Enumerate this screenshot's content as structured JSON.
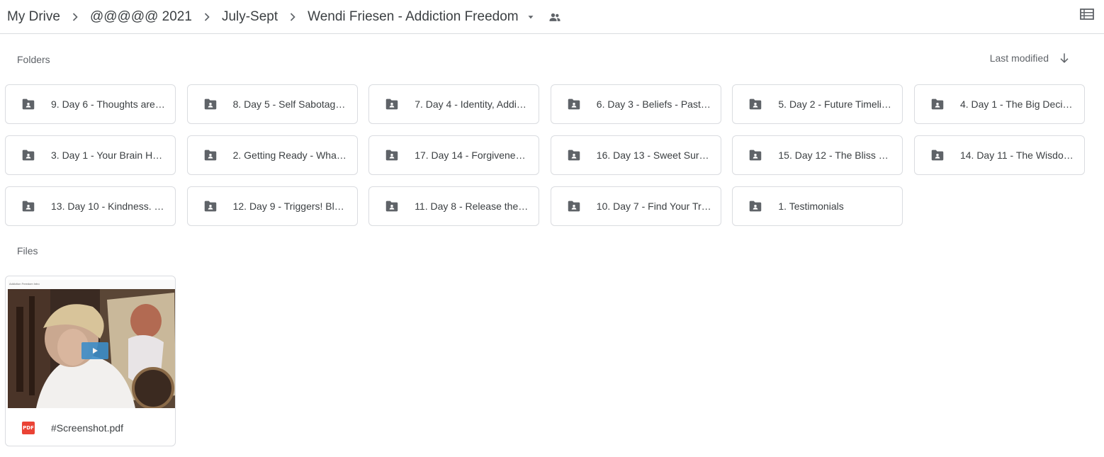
{
  "breadcrumb": {
    "items": [
      {
        "label": "My Drive"
      },
      {
        "label": "@@@@@ 2021"
      },
      {
        "label": "July-Sept"
      },
      {
        "label": "Wendi Friesen - Addiction Freedom"
      }
    ],
    "separator_icon": "chevron-right-icon",
    "dropdown_icon": "caret-down-icon",
    "shared_icon": "people-icon"
  },
  "toolbar": {
    "view_toggle_icon": "list-view-icon"
  },
  "folders_section": {
    "label": "Folders",
    "sort_label": "Last modified",
    "sort_icon": "arrow-down-icon",
    "items": [
      {
        "name": "9. Day 6 - Thoughts are…"
      },
      {
        "name": "8. Day 5 - Self Sabotag…"
      },
      {
        "name": "7. Day 4 - Identity, Addi…"
      },
      {
        "name": "6. Day 3 - Beliefs - Past…"
      },
      {
        "name": "5. Day 2 - Future Timeli…"
      },
      {
        "name": "4. Day 1 - The Big Deci…"
      },
      {
        "name": "3. Day 1 - Your Brain H…"
      },
      {
        "name": "2. Getting Ready - Wha…"
      },
      {
        "name": "17. Day 14 - Forgivene…"
      },
      {
        "name": "16. Day 13 - Sweet Sur…"
      },
      {
        "name": "15. Day 12 - The Bliss …"
      },
      {
        "name": "14. Day 11 - The Wisdo…"
      },
      {
        "name": "13. Day 10 - Kindness. …"
      },
      {
        "name": "12. Day 9 - Triggers! Bl…"
      },
      {
        "name": "11. Day 8 - Release the…"
      },
      {
        "name": "10. Day 7 - Find Your Tr…"
      },
      {
        "name": "1. Testimonials"
      }
    ],
    "folder_icon": "shared-folder-icon"
  },
  "files_section": {
    "label": "Files",
    "items": [
      {
        "name": "#Screenshot.pdf",
        "type_badge": "PDF",
        "thumb_caption": "Addiction Freedom Intro"
      }
    ]
  },
  "colors": {
    "text": "#3c4043",
    "secondary_text": "#5f6368",
    "border": "#dadce0",
    "icon": "#5f6368",
    "pdf_red": "#ea4335",
    "play_blue": "#3d8dc8"
  }
}
